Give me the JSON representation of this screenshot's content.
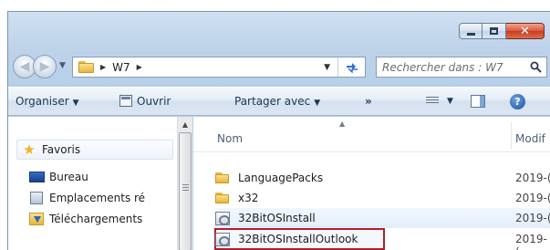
{
  "window": {
    "caption": {
      "minimize": "–",
      "maximize": "□",
      "close": "✕"
    }
  },
  "address": {
    "back_icon": "back-arrow-icon",
    "forward_icon": "forward-arrow-icon",
    "breadcrumb": [
      {
        "label": "W7"
      }
    ],
    "refresh_icon": "refresh-icon",
    "search_placeholder": "Rechercher dans : W7"
  },
  "toolbar": {
    "organise": "Organiser",
    "open": "Ouvrir",
    "share": "Partager avec",
    "more": "»",
    "help": "?"
  },
  "nav_pane": {
    "favorites": "Favoris",
    "items": [
      {
        "label": "Bureau",
        "icon": "desktop-icon"
      },
      {
        "label": "Emplacements ré",
        "icon": "recent-places-icon"
      },
      {
        "label": "Téléchargements",
        "icon": "downloads-icon"
      }
    ]
  },
  "file_list": {
    "columns": {
      "name": "Nom",
      "modified": "Modif"
    },
    "rows": [
      {
        "name": "LanguagePacks",
        "type": "folder",
        "date": "2019-("
      },
      {
        "name": "x32",
        "type": "folder",
        "date": "2019-("
      },
      {
        "name": "32BitOSInstall",
        "type": "application",
        "date": "2019-("
      },
      {
        "name": "32BitOSInstallOutlook",
        "type": "application",
        "date": "2019-("
      }
    ]
  },
  "colors": {
    "highlight_border": "#b01f24",
    "close_button": "#c63d1f",
    "chrome": "#bed3ea"
  }
}
